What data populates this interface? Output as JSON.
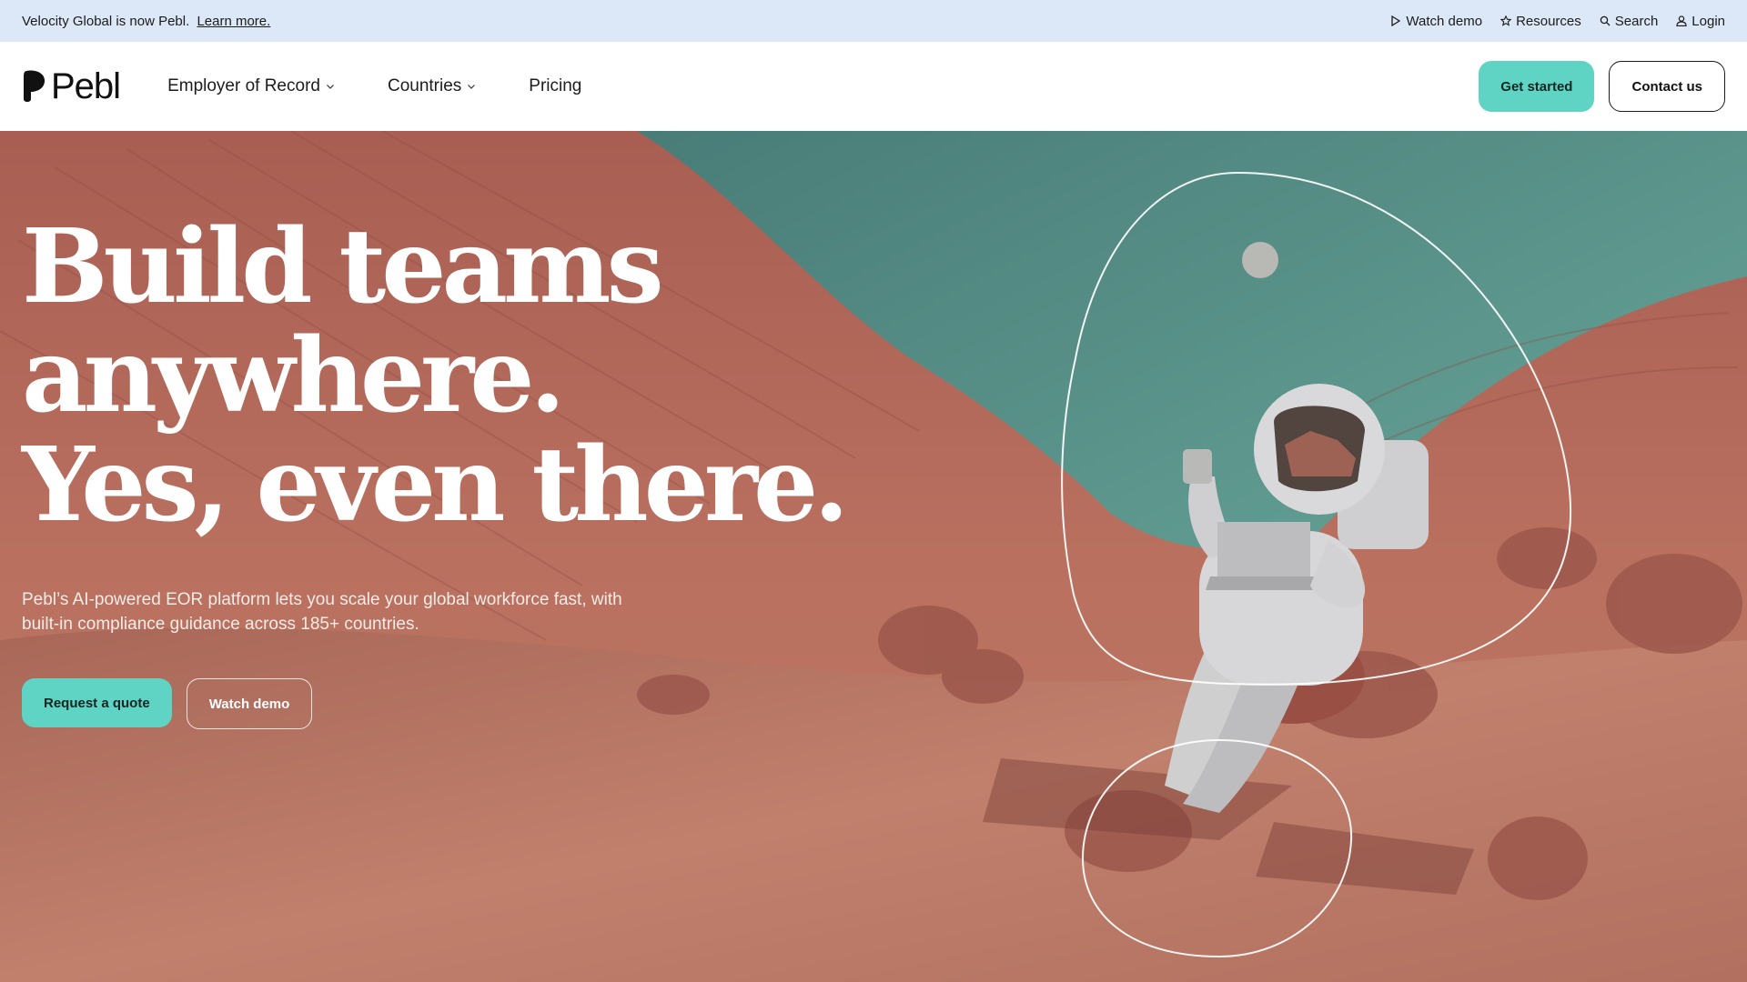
{
  "announcement": {
    "text": "Velocity Global is now Pebl.",
    "link": "Learn more."
  },
  "utility_nav": [
    {
      "label": "Watch demo",
      "icon": "play-icon"
    },
    {
      "label": "Resources",
      "icon": "star-icon"
    },
    {
      "label": "Search",
      "icon": "search-icon"
    },
    {
      "label": "Login",
      "icon": "user-icon"
    }
  ],
  "header": {
    "logo": "Pebl",
    "nav": [
      {
        "label": "Employer of Record",
        "has_dropdown": true
      },
      {
        "label": "Countries",
        "has_dropdown": true
      },
      {
        "label": "Pricing",
        "has_dropdown": false
      }
    ],
    "get_started": "Get started",
    "contact": "Contact us"
  },
  "hero": {
    "headline": [
      "Build teams",
      "anywhere.",
      "Yes, even there."
    ],
    "subtext": "Pebl’s AI-powered EOR platform lets you scale your global workforce fast, with built-in compliance guidance across 185+ countries.",
    "primary_cta": "Request a quote",
    "secondary_cta": "Watch demo"
  },
  "colors": {
    "announcement_bg": "#dce8f7",
    "accent": "#5fd4c4",
    "sky": "#4f8f86",
    "terrain": "#b4685a"
  }
}
